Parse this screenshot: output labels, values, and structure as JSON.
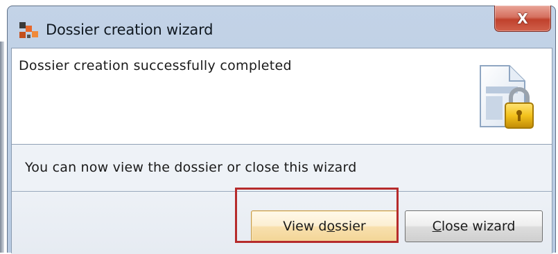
{
  "window": {
    "title": "Dossier creation wizard",
    "close_label": "X"
  },
  "header": {
    "success_text": "Dossier creation successfully completed",
    "icon": "locked-document-icon"
  },
  "message": {
    "text": "You can now view the dossier or close this wizard"
  },
  "buttons": {
    "view_pre": "View d",
    "view_mnemonic": "o",
    "view_post": "ssier",
    "close_mnemonic": "C",
    "close_post": "lose wizard"
  },
  "colors": {
    "highlight": "#b62b2b",
    "close_button": "#c0412c",
    "title_bar": "#c3d3e7"
  }
}
